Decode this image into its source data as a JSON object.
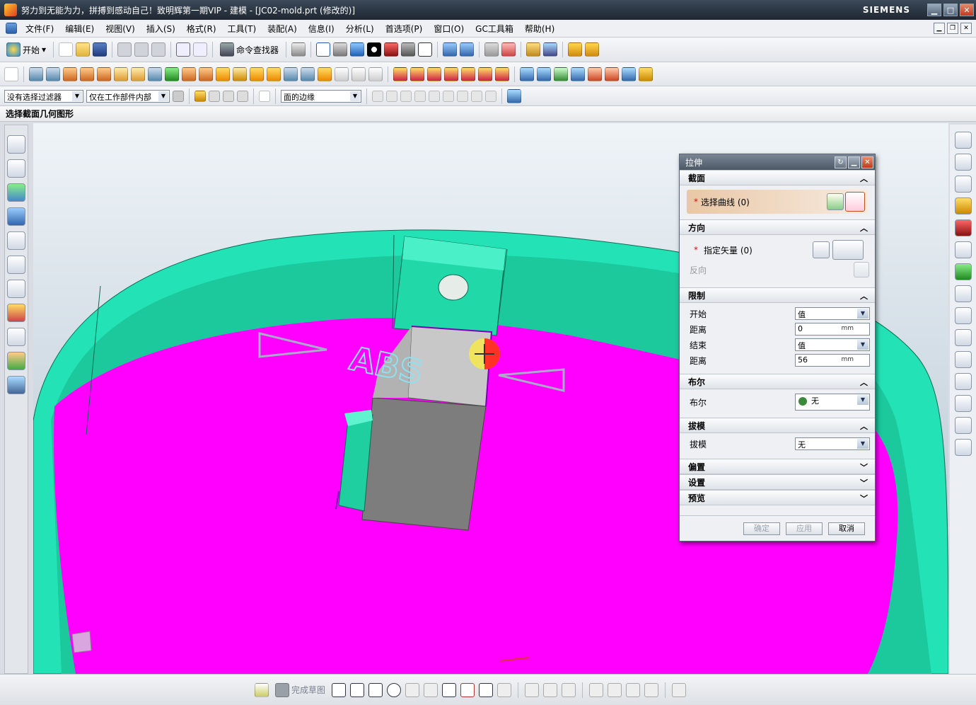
{
  "window": {
    "title": "努力到无能为力，拼搏到感动自己！致明辉第一期VIP - 建模 - [JC02-mold.prt (修改的)]",
    "brand": "SIEMENS",
    "minimize": "▁",
    "maximize": "□",
    "close": "✕"
  },
  "menu": {
    "items": [
      "文件(F)",
      "编辑(E)",
      "视图(V)",
      "插入(S)",
      "格式(R)",
      "工具(T)",
      "装配(A)",
      "信息(I)",
      "分析(L)",
      "首选项(P)",
      "窗口(O)",
      "GC工具箱",
      "帮助(H)"
    ]
  },
  "toolbar": {
    "start_label": "开始",
    "command_finder_label": "命令查找器"
  },
  "filters": {
    "selection_filter": "没有选择过滤器",
    "scope": "仅在工作部件内部",
    "curve_rule": "面的边缘"
  },
  "cue": {
    "prompt": "选择截面几何图形"
  },
  "viewport": {
    "text_label": "ABS"
  },
  "dialog": {
    "title": "拉伸",
    "section": {
      "header": "截面",
      "select_curve": "选择曲线 (0)"
    },
    "direction": {
      "header": "方向",
      "specify_vector": "指定矢量 (0)",
      "reverse": "反向"
    },
    "limits": {
      "header": "限制",
      "start_label": "开始",
      "start_value": "值",
      "distance1_label": "距离",
      "distance1_value": "0",
      "end_label": "结束",
      "end_value": "值",
      "distance2_label": "距离",
      "distance2_value": "56",
      "unit": "mm"
    },
    "boolean": {
      "header": "布尔",
      "label": "布尔",
      "value": "无"
    },
    "draft": {
      "header": "拔模",
      "label": "拔模",
      "value": "无"
    },
    "offset_header": "偏置",
    "settings_header": "设置",
    "preview_header": "预览",
    "buttons": {
      "ok": "确定",
      "apply": "应用",
      "cancel": "取消"
    }
  },
  "sketch_bar": {
    "finish_sketch": "完成草图"
  },
  "colors": {
    "model_face": "#ff00ff",
    "model_wall": "#1de8b0",
    "model_box": "#7d7d7d"
  }
}
